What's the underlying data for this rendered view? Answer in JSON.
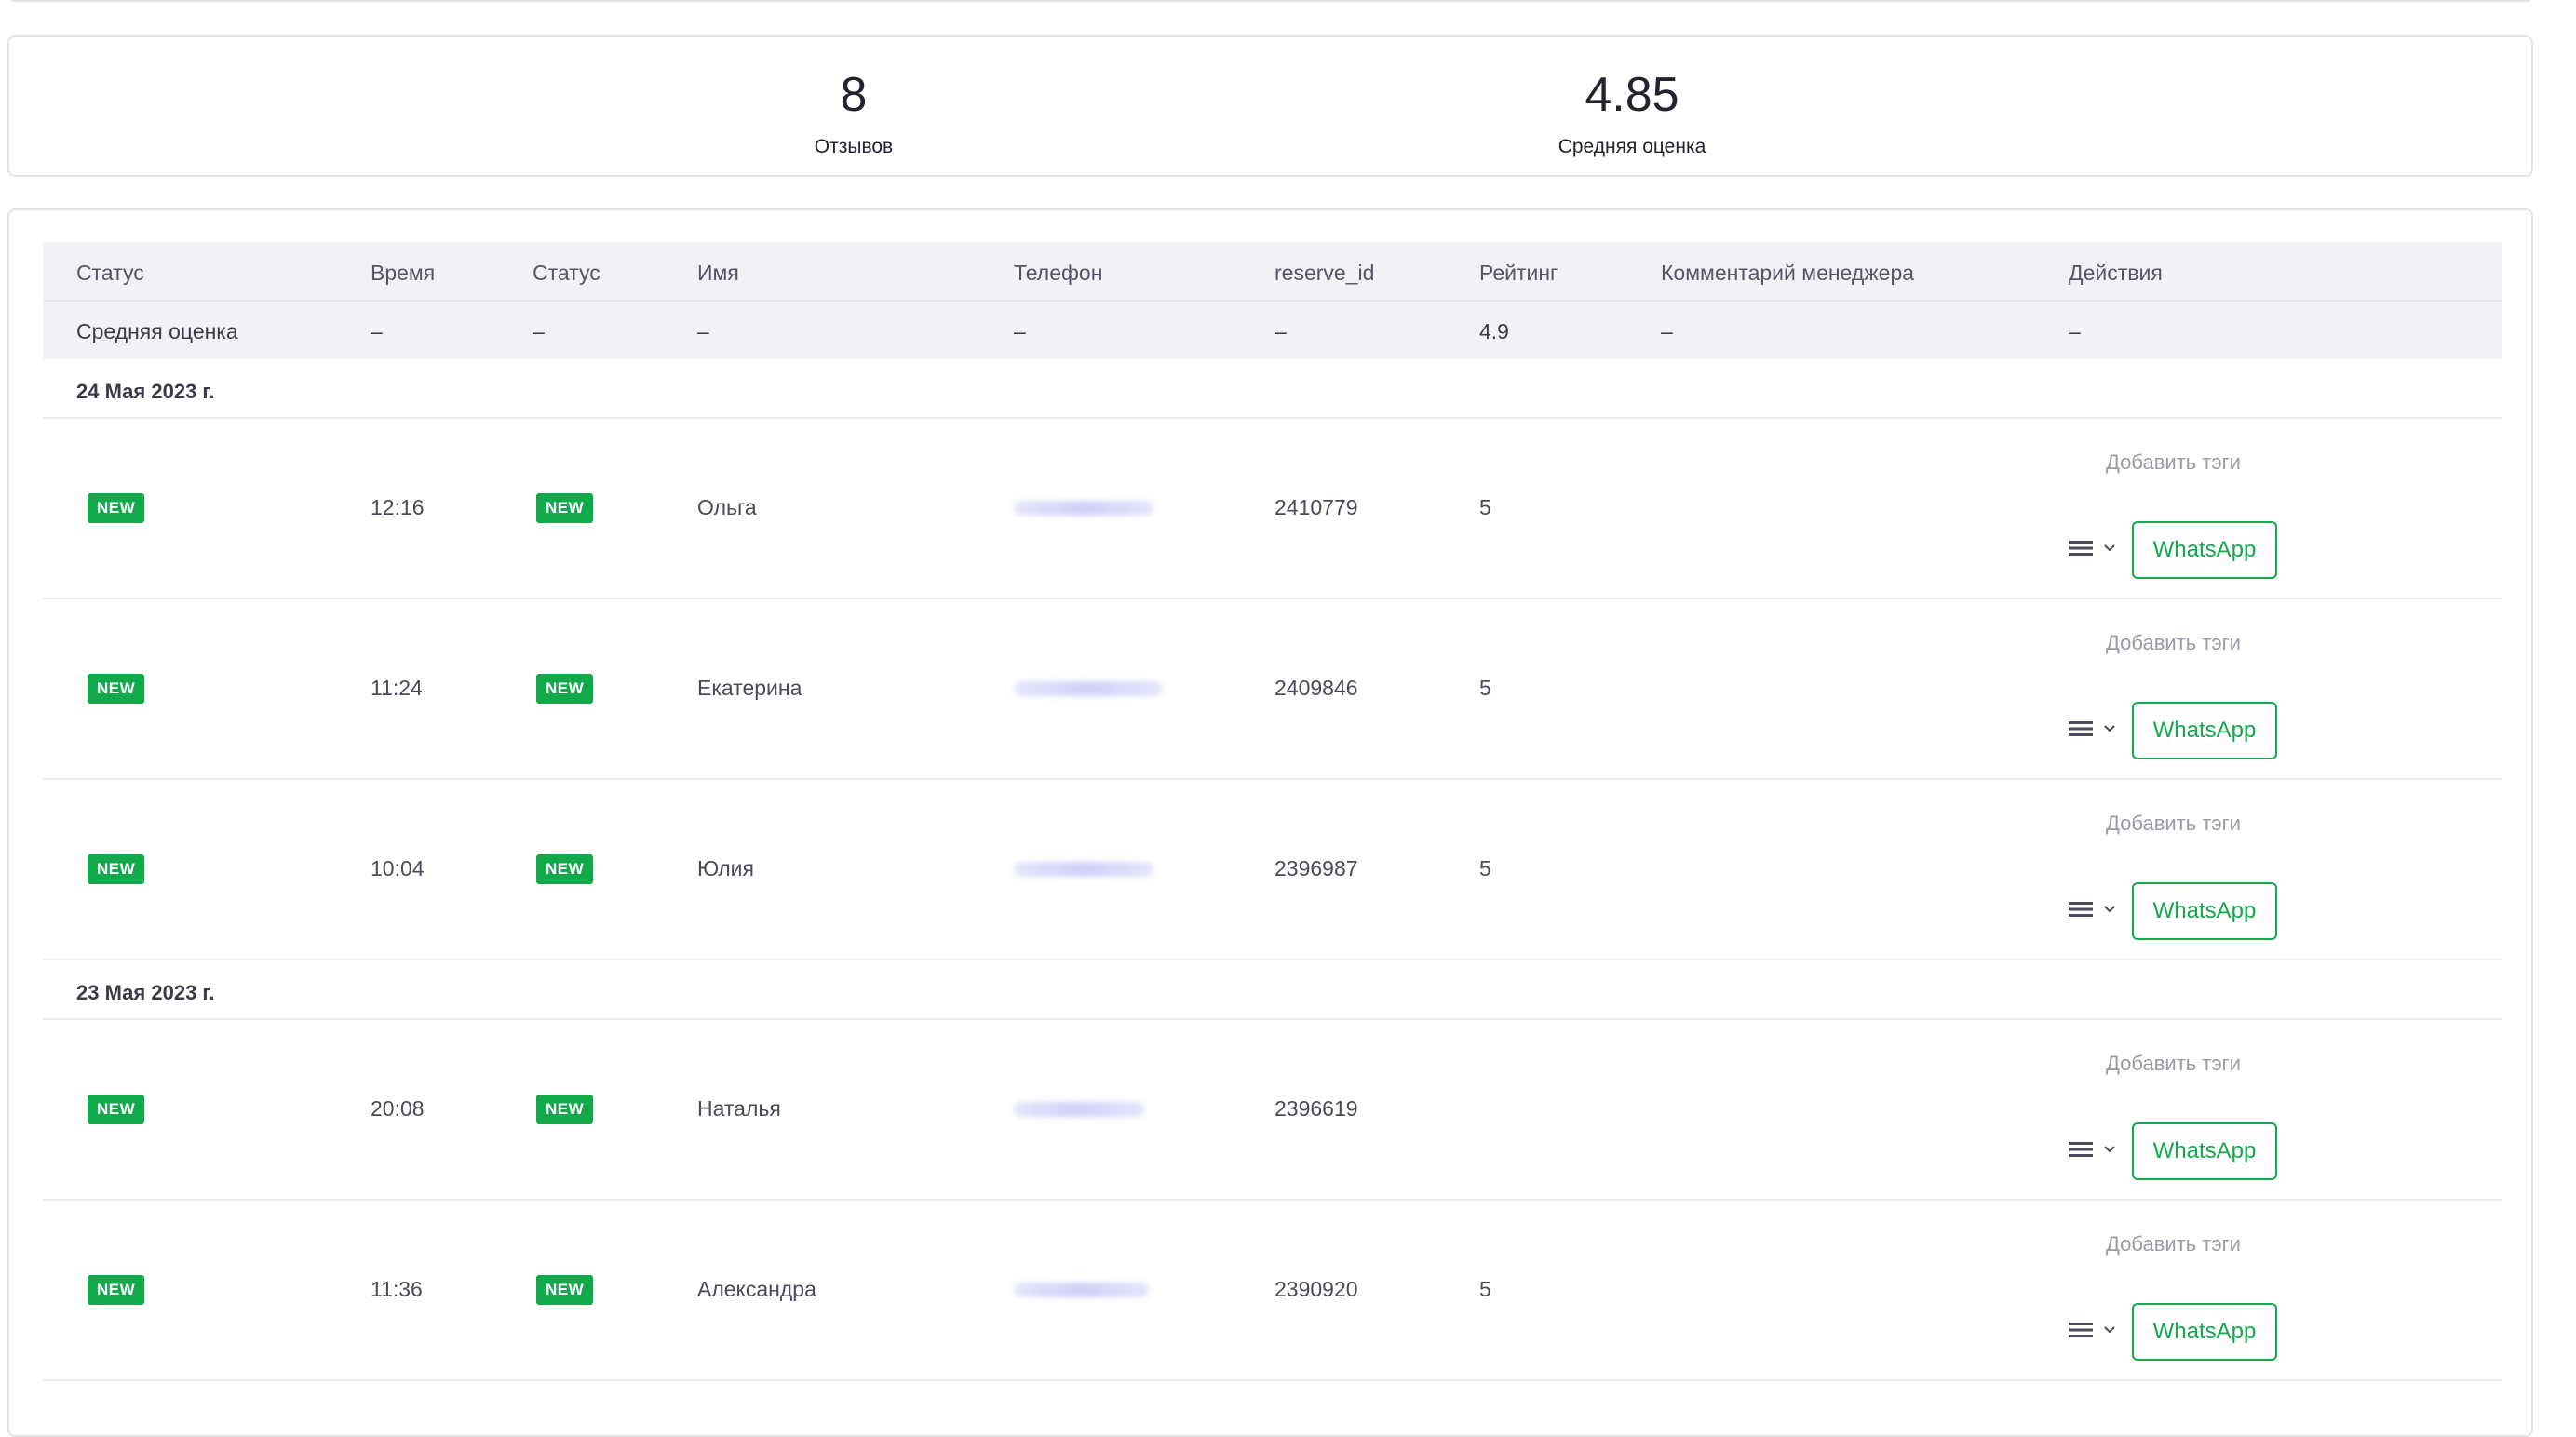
{
  "stats": {
    "reviews_count": "8",
    "reviews_label": "Отзывов",
    "avg_rating": "4.85",
    "avg_label": "Средняя оценка"
  },
  "table": {
    "headers": {
      "status": "Статус",
      "time": "Время",
      "status2": "Статус",
      "name": "Имя",
      "phone": "Телефон",
      "reserve_id": "reserve_id",
      "rating": "Рейтинг",
      "comment": "Комментарий менеджера",
      "actions": "Действия"
    },
    "average_row": {
      "label": "Средняя оценка",
      "time": "–",
      "status2": "–",
      "name": "–",
      "phone": "–",
      "reserve_id": "–",
      "rating": "4.9",
      "comment": "–",
      "actions": "–"
    },
    "groups": [
      {
        "date": "24 Мая 2023 г.",
        "rows": [
          {
            "status": "NEW",
            "time": "12:16",
            "status2": "NEW",
            "name": "Ольга",
            "reserve_id": "2410779",
            "rating": "5",
            "add_tags": "Добавить тэги",
            "whatsapp": "WhatsApp"
          },
          {
            "status": "NEW",
            "time": "11:24",
            "status2": "NEW",
            "name": "Екатерина",
            "reserve_id": "2409846",
            "rating": "5",
            "add_tags": "Добавить тэги",
            "whatsapp": "WhatsApp"
          },
          {
            "status": "NEW",
            "time": "10:04",
            "status2": "NEW",
            "name": "Юлия",
            "reserve_id": "2396987",
            "rating": "5",
            "add_tags": "Добавить тэги",
            "whatsapp": "WhatsApp"
          }
        ]
      },
      {
        "date": "23 Мая 2023 г.",
        "rows": [
          {
            "status": "NEW",
            "time": "20:08",
            "status2": "NEW",
            "name": "Наталья",
            "reserve_id": "2396619",
            "rating": "",
            "add_tags": "Добавить тэги",
            "whatsapp": "WhatsApp"
          },
          {
            "status": "NEW",
            "time": "11:36",
            "status2": "NEW",
            "name": "Александра",
            "reserve_id": "2390920",
            "rating": "5",
            "add_tags": "Добавить тэги",
            "whatsapp": "WhatsApp"
          }
        ]
      }
    ]
  },
  "colors": {
    "accent_green": "#12a94b",
    "header_bg": "#f1f1f6",
    "border": "#e3e3ea"
  },
  "icons": {
    "menu": "hamburger-icon",
    "dropdown": "chevron-down-icon"
  }
}
